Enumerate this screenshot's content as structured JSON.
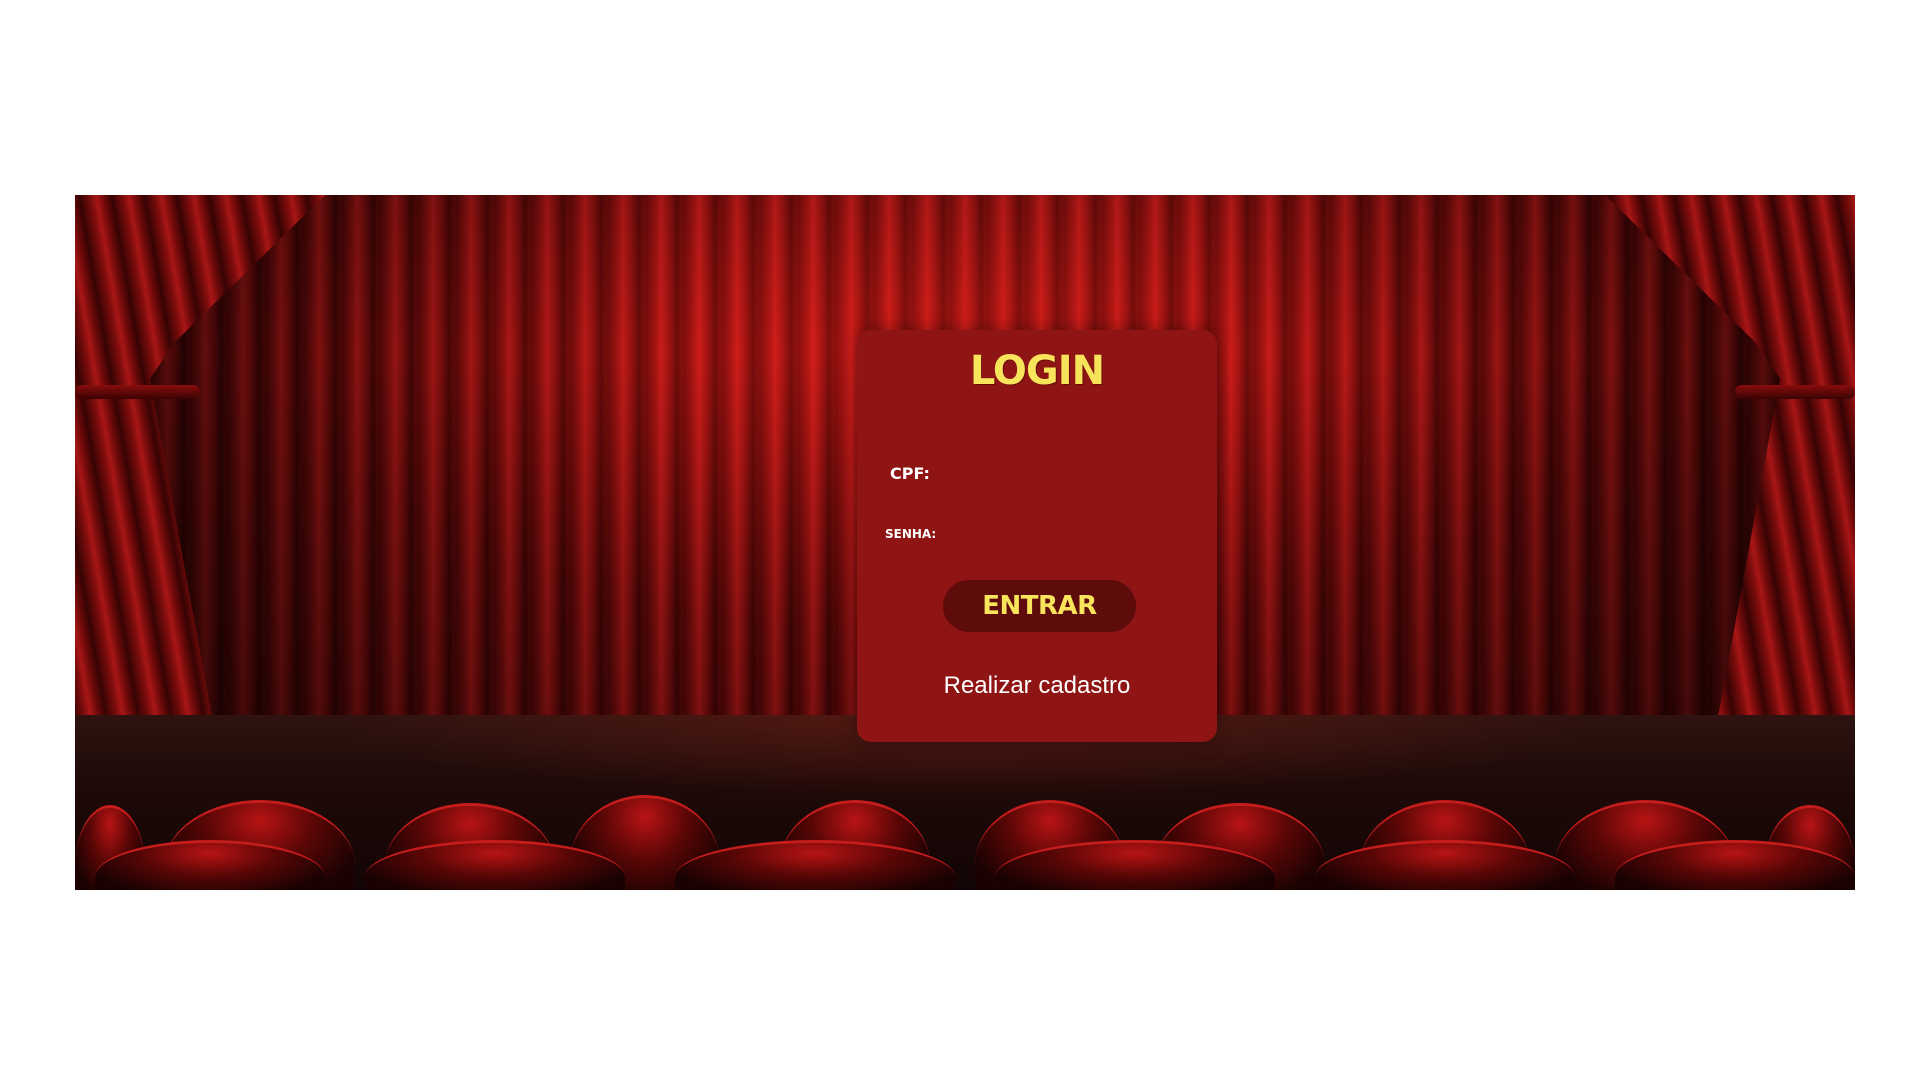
{
  "login": {
    "title": "LOGIN",
    "cpf_label": "CPF:",
    "cpf_value": "",
    "senha_label": "SENHA:",
    "senha_value": "",
    "submit_label": "ENTRAR",
    "register_link": "Realizar cadastro"
  },
  "colors": {
    "card_background": "#8f1515",
    "title_yellow": "#f7e45a",
    "button_background": "#5e0b0b",
    "page_background": "#ffffff"
  },
  "icons": {
    "background": "theater-stage-curtain-image"
  }
}
